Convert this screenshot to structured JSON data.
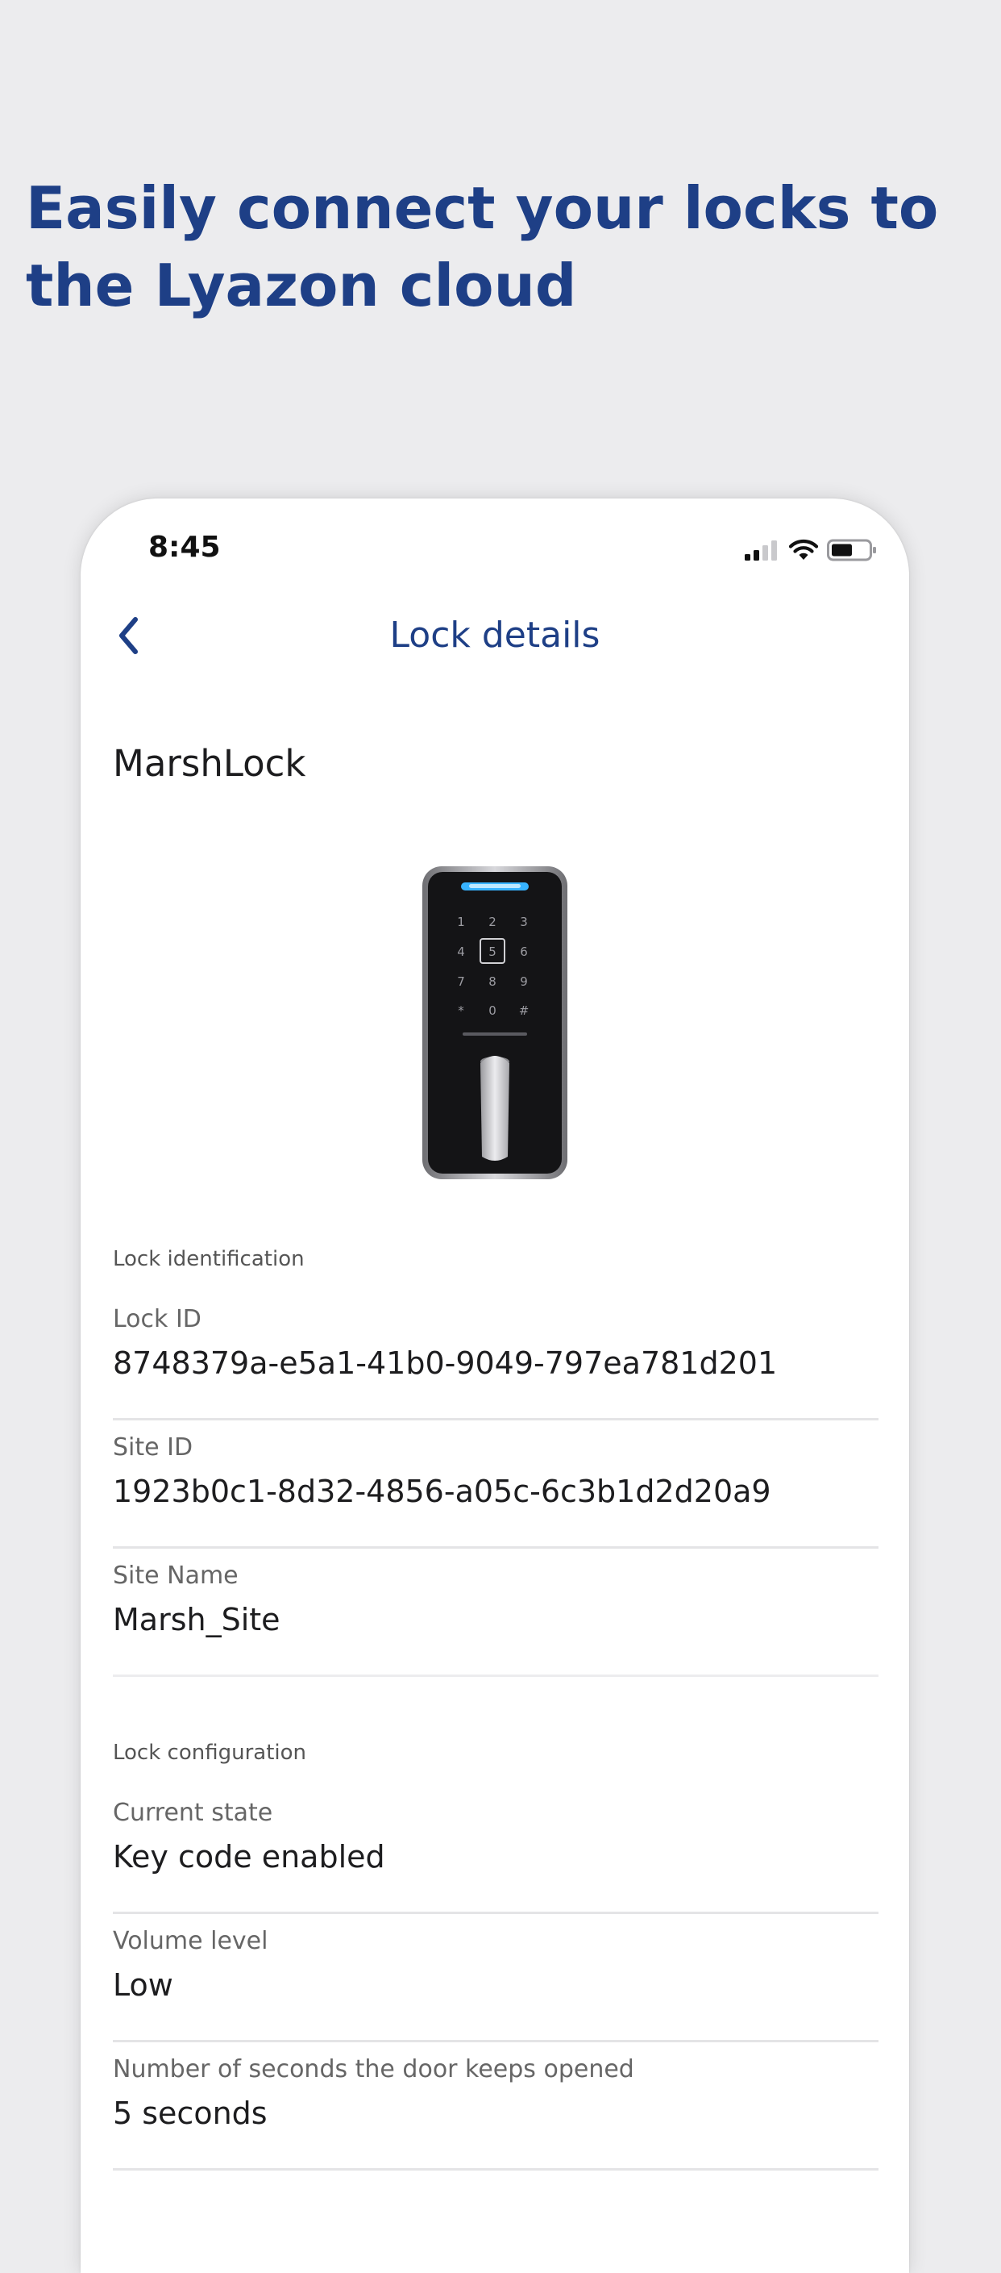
{
  "headline": "Easily connect your locks to the Lyazon cloud",
  "status_bar": {
    "time": "8:45",
    "icons": [
      "signal-icon",
      "wifi-icon",
      "battery-icon"
    ]
  },
  "nav": {
    "back_icon": "chevron-left-icon",
    "title": "Lock details"
  },
  "lock": {
    "name": "MarshLock",
    "keypad_keys": [
      "1",
      "2",
      "3",
      "4",
      "5",
      "6",
      "7",
      "8",
      "9",
      "*",
      "0",
      "#"
    ]
  },
  "identification": {
    "section_label": "Lock identification",
    "fields": [
      {
        "label": "Lock ID",
        "value": "8748379a-e5a1-41b0-9049-797ea781d201"
      },
      {
        "label": "Site ID",
        "value": "1923b0c1-8d32-4856-a05c-6c3b1d2d20a9"
      },
      {
        "label": "Site Name",
        "value": "Marsh_Site"
      }
    ]
  },
  "configuration": {
    "section_label": "Lock configuration",
    "fields": [
      {
        "label": "Current state",
        "value": "Key code enabled"
      },
      {
        "label": "Volume level",
        "value": "Low"
      },
      {
        "label": "Number of seconds the door keeps opened",
        "value": "5 seconds"
      }
    ]
  },
  "colors": {
    "brand_blue": "#1e3f86",
    "background": "#ececee",
    "card": "#ffffff",
    "divider": "#e4e4e6"
  }
}
